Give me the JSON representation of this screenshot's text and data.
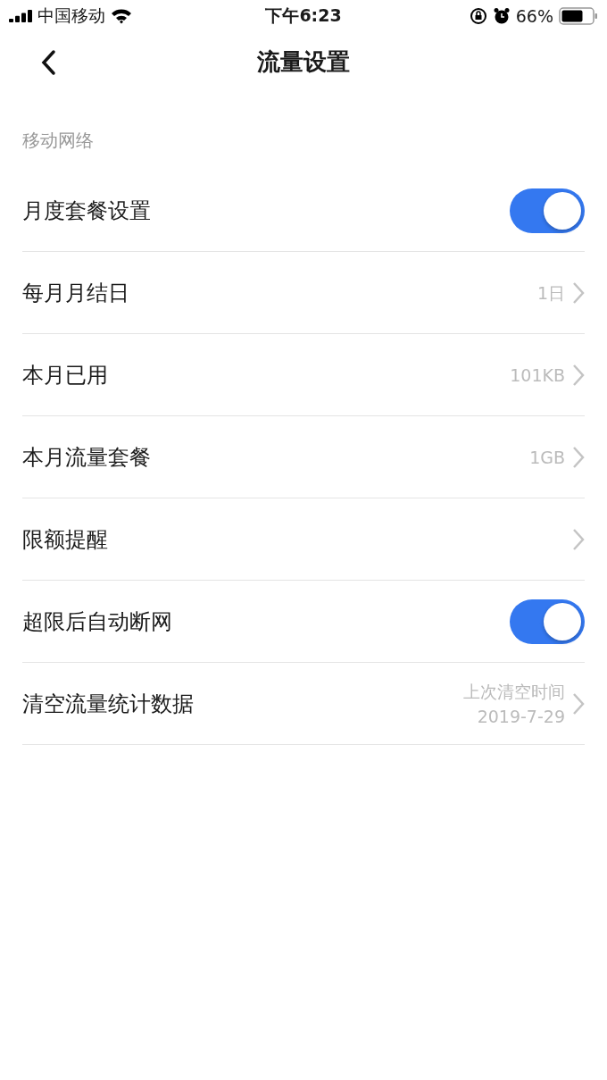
{
  "status_bar": {
    "carrier": "中国移动",
    "time": "下午6:23",
    "battery": "66%"
  },
  "nav": {
    "title": "流量设置"
  },
  "section": {
    "title": "移动网络"
  },
  "rows": [
    {
      "kind": "toggle",
      "label": "月度套餐设置",
      "on": true
    },
    {
      "kind": "link",
      "label": "每月月结日",
      "values": [
        "1日"
      ]
    },
    {
      "kind": "link",
      "label": "本月已用",
      "values": [
        "101KB"
      ]
    },
    {
      "kind": "link",
      "label": "本月流量套餐",
      "values": [
        "1GB"
      ]
    },
    {
      "kind": "link",
      "label": "限额提醒"
    },
    {
      "kind": "toggle",
      "label": "超限后自动断网",
      "on": true
    },
    {
      "kind": "link",
      "label": "清空流量统计数据",
      "values": [
        "上次清空时间",
        "2019-7-29"
      ]
    }
  ]
}
